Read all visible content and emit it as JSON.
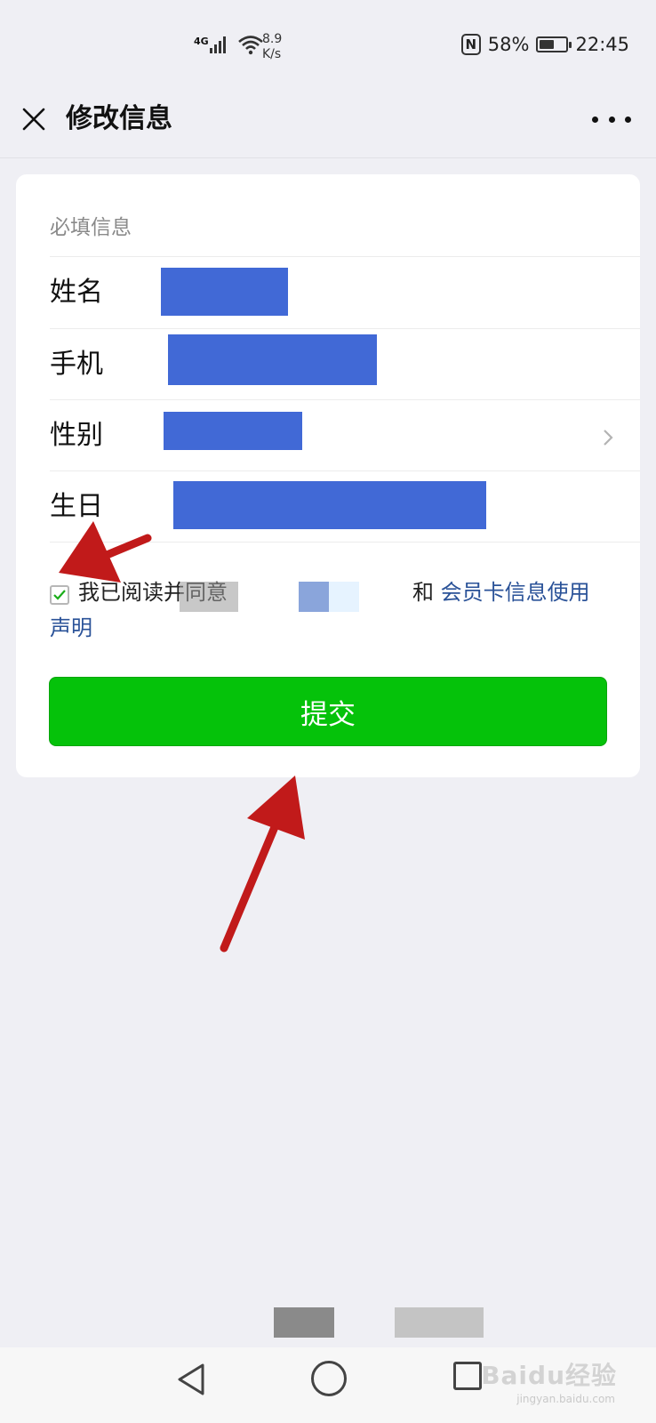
{
  "status_bar": {
    "network": "4G",
    "speed_value": "8.9",
    "speed_unit": "K/s",
    "battery": "58%",
    "battery_level": 0.58,
    "time": "22:45",
    "nfc_label": "N"
  },
  "nav": {
    "title": "修改信息",
    "close_icon": "close-icon",
    "more_icon": "more-icon"
  },
  "form": {
    "section_title": "必填信息",
    "fields": [
      {
        "label": "姓名"
      },
      {
        "label": "手机"
      },
      {
        "label": "性别"
      },
      {
        "label": "生日"
      }
    ],
    "agreement": {
      "prefix": "我已阅读并同意",
      "conjunction": "和",
      "link": "会员卡信息使用声明"
    },
    "submit_label": "提交"
  },
  "watermark": {
    "text": "Baidu经验",
    "subtext": "jingyan.baidu.com"
  },
  "colors": {
    "accent_green": "#05c20a",
    "mask_blue": "#4169d6",
    "link_blue": "#2a5298",
    "arrow_red": "#c11a1a"
  }
}
